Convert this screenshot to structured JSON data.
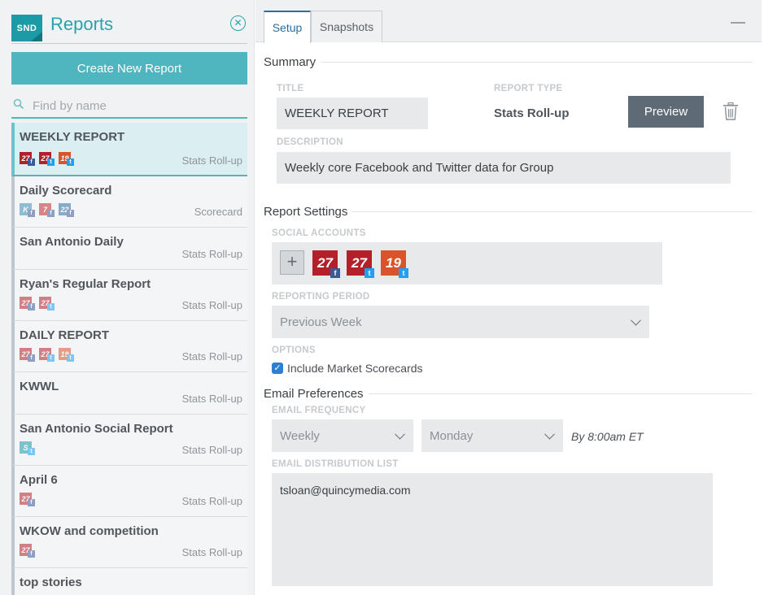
{
  "sidebar": {
    "logo_text": "SND",
    "title": "Reports",
    "close_icon": "circle-x-icon",
    "create_label": "Create New Report",
    "search_placeholder": "Find by name",
    "reports": [
      {
        "name": "WEEKLY REPORT",
        "type": "Stats Roll-up",
        "active": true,
        "icons": [
          {
            "label": "27",
            "color": "#b3202a",
            "badge": "fb"
          },
          {
            "label": "27",
            "color": "#b3202a",
            "badge": "tw"
          },
          {
            "label": "19",
            "color": "#d9542a",
            "badge": "tw"
          }
        ]
      },
      {
        "name": "Daily Scorecard",
        "type": "Scorecard",
        "icons": [
          {
            "label": "K",
            "color": "#3d8fb8",
            "badge": "fb"
          },
          {
            "label": "7",
            "color": "#c0272d",
            "badge": "fb"
          },
          {
            "label": "22",
            "color": "#2d6ea6",
            "badge": "fb"
          }
        ]
      },
      {
        "name": "San Antonio Daily",
        "type": "Stats Roll-up",
        "icons": []
      },
      {
        "name": "Ryan's Regular Report",
        "type": "Stats Roll-up",
        "icons": [
          {
            "label": "27",
            "color": "#b3202a",
            "badge": "fb"
          },
          {
            "label": "27",
            "color": "#b3202a",
            "badge": "tw"
          }
        ]
      },
      {
        "name": "DAILY REPORT",
        "type": "Stats Roll-up",
        "icons": [
          {
            "label": "27",
            "color": "#b3202a",
            "badge": "fb"
          },
          {
            "label": "27",
            "color": "#b3202a",
            "badge": "tw"
          },
          {
            "label": "19",
            "color": "#d9542a",
            "badge": "tw"
          }
        ]
      },
      {
        "name": "KWWL",
        "type": "Stats Roll-up",
        "icons": []
      },
      {
        "name": "San Antonio Social Report",
        "type": "Stats Roll-up",
        "icons": [
          {
            "label": "S",
            "color": "#1c9aa5",
            "badge": "tw"
          }
        ]
      },
      {
        "name": "April 6",
        "type": "Stats Roll-up",
        "icons": [
          {
            "label": "27",
            "color": "#b3202a",
            "badge": "fb"
          }
        ]
      },
      {
        "name": "WKOW and competition",
        "type": "Stats Roll-up",
        "icons": [
          {
            "label": "27",
            "color": "#b3202a",
            "badge": "fb"
          }
        ]
      },
      {
        "name": "top stories",
        "type": "",
        "icons": []
      }
    ]
  },
  "tabs": {
    "setup": "Setup",
    "snapshots": "Snapshots"
  },
  "summary": {
    "heading": "Summary",
    "title_label": "TITLE",
    "title_value": "WEEKLY REPORT",
    "report_type_label": "REPORT TYPE",
    "report_type_value": "Stats Roll-up",
    "preview_label": "Preview",
    "description_label": "DESCRIPTION",
    "description_value": "Weekly core Facebook and Twitter data for Group"
  },
  "report_settings": {
    "heading": "Report Settings",
    "social_accounts_label": "SOCIAL ACCOUNTS",
    "add_symbol": "+",
    "accounts": [
      {
        "label": "27",
        "color": "#b3202a",
        "badge": "fb"
      },
      {
        "label": "27",
        "color": "#b3202a",
        "badge": "tw"
      },
      {
        "label": "19",
        "color": "#d9542a",
        "badge": "tw"
      }
    ],
    "period_label": "REPORTING PERIOD",
    "period_value": "Previous Week",
    "options_label": "OPTIONS",
    "option_market": "Include Market Scorecards"
  },
  "email": {
    "heading": "Email Preferences",
    "frequency_label": "EMAIL FREQUENCY",
    "frequency_value": "Weekly",
    "day_value": "Monday",
    "time_note": "By 8:00am ET",
    "distribution_label": "EMAIL DISTRIBUTION LIST",
    "distribution_value": "tsloan@quincymedia.com"
  }
}
